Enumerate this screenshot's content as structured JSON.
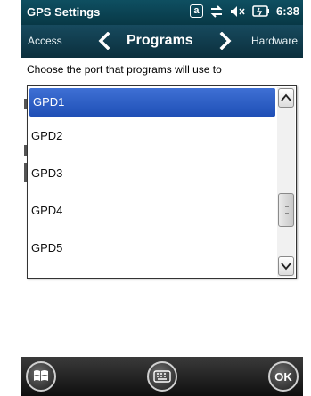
{
  "status_bar": {
    "title": "GPS Settings",
    "alpha_indicator": "a",
    "time": "6:38",
    "icons": [
      "alpha-mode-icon",
      "connectivity-icon",
      "speaker-muted-icon",
      "battery-icon"
    ]
  },
  "tabs": {
    "previous": "Access",
    "current": "Programs",
    "next": "Hardware"
  },
  "content": {
    "instruction": "Choose the port that programs will use to"
  },
  "port_list": {
    "selected": "GPD1",
    "items": [
      "GPD1",
      "GPD2",
      "GPD3",
      "GPD4",
      "GPD5"
    ]
  },
  "bottom_bar": {
    "ok_label": "OK"
  },
  "colors": {
    "header": "#0b3f4e",
    "selection": "#2a5ac4",
    "bottom_bar": "#1a1a1a"
  }
}
